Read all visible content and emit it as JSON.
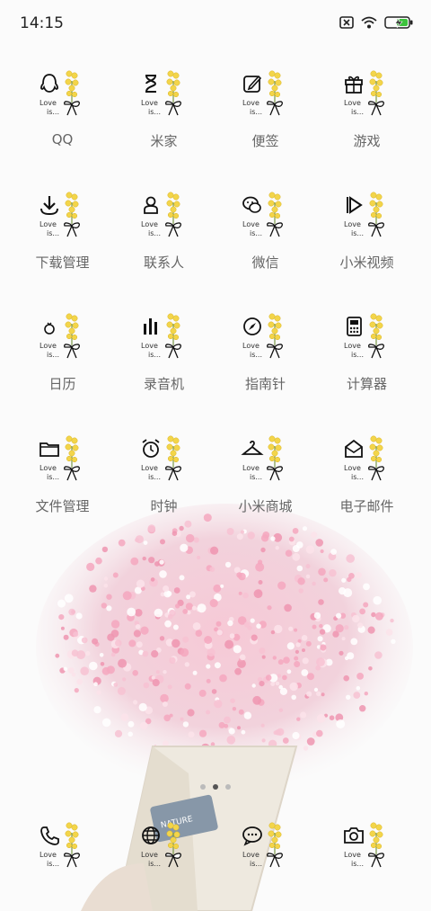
{
  "status_bar": {
    "time": "14:15",
    "icons": [
      "sim-off-icon",
      "wifi-icon",
      "battery-charging-icon"
    ]
  },
  "apps": [
    {
      "label": "QQ",
      "icon": "qq-penguin-icon"
    },
    {
      "label": "米家",
      "icon": "hourglass-icon"
    },
    {
      "label": "便签",
      "icon": "note-edit-icon"
    },
    {
      "label": "游戏",
      "icon": "gift-icon"
    },
    {
      "label": "下载管理",
      "icon": "download-icon"
    },
    {
      "label": "联系人",
      "icon": "contact-person-icon"
    },
    {
      "label": "微信",
      "icon": "wechat-icon"
    },
    {
      "label": "小米视频",
      "icon": "play-icon"
    },
    {
      "label": "日历",
      "icon": "calendar-ring-icon"
    },
    {
      "label": "录音机",
      "icon": "recorder-bars-icon"
    },
    {
      "label": "指南针",
      "icon": "compass-icon"
    },
    {
      "label": "计算器",
      "icon": "calculator-icon"
    },
    {
      "label": "文件管理",
      "icon": "folder-icon"
    },
    {
      "label": "时钟",
      "icon": "alarm-clock-icon"
    },
    {
      "label": "小米商城",
      "icon": "hanger-icon"
    },
    {
      "label": "电子邮件",
      "icon": "mail-icon"
    }
  ],
  "dock": [
    {
      "icon": "phone-icon"
    },
    {
      "icon": "globe-browser-icon"
    },
    {
      "icon": "message-bubble-icon"
    },
    {
      "icon": "camera-icon"
    }
  ],
  "icon_text": {
    "line1": "Love",
    "line2": "is..."
  },
  "bouquet_tag": "NATURE",
  "page_indicator": {
    "count": 3,
    "active": 1
  }
}
